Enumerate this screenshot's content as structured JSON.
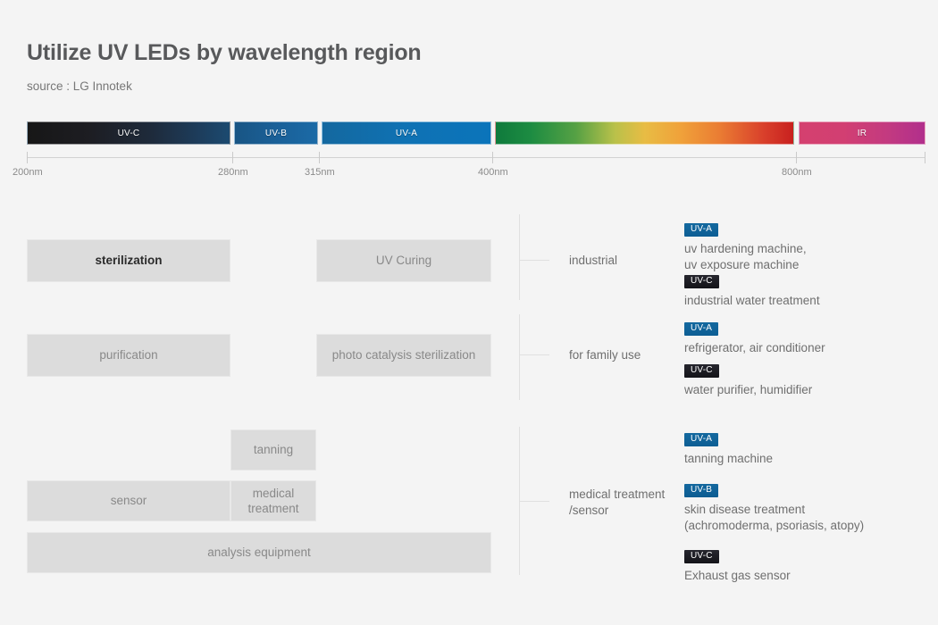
{
  "header": {
    "title": "Utilize UV LEDs by wavelength region",
    "source": "source : LG Innotek"
  },
  "spectrum": {
    "bands": [
      {
        "id": "uvc",
        "label": "UV-C",
        "range_nm": [
          200,
          280
        ]
      },
      {
        "id": "uvb",
        "label": "UV-B",
        "range_nm": [
          280,
          315
        ]
      },
      {
        "id": "uva",
        "label": "UV-A",
        "range_nm": [
          315,
          400
        ]
      },
      {
        "id": "visible",
        "label": "",
        "range_nm": [
          400,
          800
        ]
      },
      {
        "id": "ir",
        "label": "IR",
        "range_nm": [
          800,
          1000
        ]
      }
    ],
    "axis_labels": [
      "200nm",
      "280nm",
      "315nm",
      "400nm",
      "800nm"
    ]
  },
  "application_boxes": [
    {
      "id": "sterilization",
      "label": "sterilization",
      "emphasis": true
    },
    {
      "id": "uv-curing",
      "label": "UV Curing",
      "emphasis": false
    },
    {
      "id": "purification",
      "label": "purification",
      "emphasis": false
    },
    {
      "id": "photo-catalysis-sterilization",
      "label": "photo catalysis\nsterilization",
      "emphasis": false
    },
    {
      "id": "tanning",
      "label": "tanning",
      "emphasis": false
    },
    {
      "id": "sensor",
      "label": "sensor",
      "emphasis": false
    },
    {
      "id": "medical-treatment",
      "label": "medical\ntreatment",
      "emphasis": false
    },
    {
      "id": "analysis-equipment",
      "label": "analysis equipment",
      "emphasis": false
    }
  ],
  "categories": [
    {
      "id": "industrial",
      "label": "industrial",
      "items": [
        {
          "badge": "UV-A",
          "badge_type": "uv-a",
          "text": "uv hardening machine,\nuv exposure machine"
        },
        {
          "badge": "UV-C",
          "badge_type": "uv-c",
          "text": "industrial water treatment"
        }
      ]
    },
    {
      "id": "for-family-use",
      "label": "for family use",
      "items": [
        {
          "badge": "UV-A",
          "badge_type": "uv-a",
          "text": "refrigerator, air conditioner"
        },
        {
          "badge": "UV-C",
          "badge_type": "uv-c",
          "text": "water purifier, humidifier"
        }
      ]
    },
    {
      "id": "medical-treatment-sensor",
      "label": "medical treatment\n/sensor",
      "items": [
        {
          "badge": "UV-A",
          "badge_type": "uv-a",
          "text": "tanning machine"
        },
        {
          "badge": "UV-B",
          "badge_type": "uv-b",
          "text": "skin disease treatment\n(achromoderma, psoriasis, atopy)"
        },
        {
          "badge": "UV-C",
          "badge_type": "uv-c",
          "text": "Exhaust gas sensor"
        }
      ]
    }
  ],
  "colors": {
    "background": "#f4f4f4",
    "box_fill": "#dcdcdc",
    "uv_a_badge": "#0f6aa0",
    "uv_b_badge": "#0f6aa0",
    "uv_c_badge": "#1a1a20",
    "title_text": "#58595b"
  }
}
